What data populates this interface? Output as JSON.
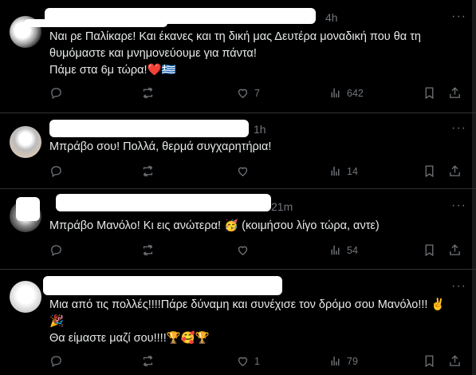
{
  "posts": [
    {
      "time": "4h",
      "more": "···",
      "text": "Ναι ρε Παλίκαρε! Και έκανες και τη δική μας Δευτέρα μοναδική που θα τη θυμόμαστε και μνημονεύουμε για πάντα!\nΠάμε στα 6μ τώρα!❤️🇬🇷",
      "likes": "7",
      "views": "642"
    },
    {
      "time": "1h",
      "more": "···",
      "text": "Μπράβο σου! Πολλά, θερμά συγχαρητήρια!",
      "likes": "",
      "views": "14"
    },
    {
      "time": "21m",
      "more": "···",
      "text": "Μπράβο Μανόλο! Κι εις ανώτερα! 🥳 (κοιμήσου λίγο τώρα, αντε)",
      "likes": "",
      "views": "54"
    },
    {
      "time": "",
      "more": "···",
      "text": "Μια από τις πολλές!!!!Πάρε δύναμη και συνέχισε τον δρόμο σου Μανόλο!!! ✌️\n🎉\nΘα είμαστε μαζί σου!!!!🏆🥰🏆",
      "likes": "1",
      "views": "79"
    }
  ]
}
